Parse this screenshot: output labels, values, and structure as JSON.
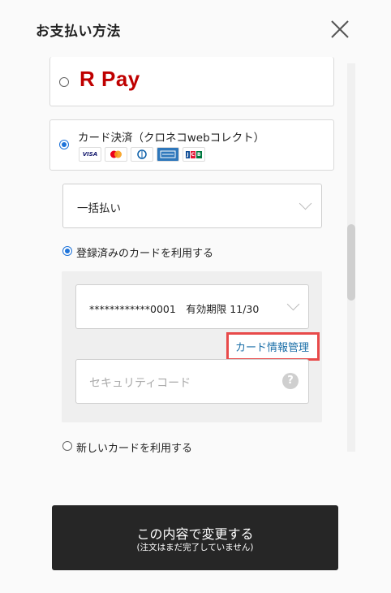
{
  "header": {
    "title": "お支払い方法"
  },
  "rpay": {
    "logo_text": "R Pay",
    "selected": false,
    "brand_color": "#bf0000"
  },
  "card_option": {
    "label": "カード決済（クロネコwebコレクト）",
    "selected": true,
    "card_brands": [
      "VISA",
      "Mastercard",
      "Diners Club",
      "American Express",
      "JCB"
    ]
  },
  "installment": {
    "selected_value": "一括払い"
  },
  "registered": {
    "label": "登録済みのカードを利用する",
    "selected": true,
    "card_value": "************0001　有効期限 11/30",
    "manage_link": "カード情報管理",
    "security_placeholder": "セキュリティコード",
    "help_symbol": "?"
  },
  "new_card": {
    "label": "新しいカードを利用する",
    "selected": false
  },
  "submit": {
    "label": "この内容で変更する",
    "sub_label": "(注文はまだ完了していません)"
  },
  "colors": {
    "accent": "#1e73d9",
    "link": "#1b6fa8",
    "highlight": "#e84a4a",
    "button_bg": "#262626"
  }
}
